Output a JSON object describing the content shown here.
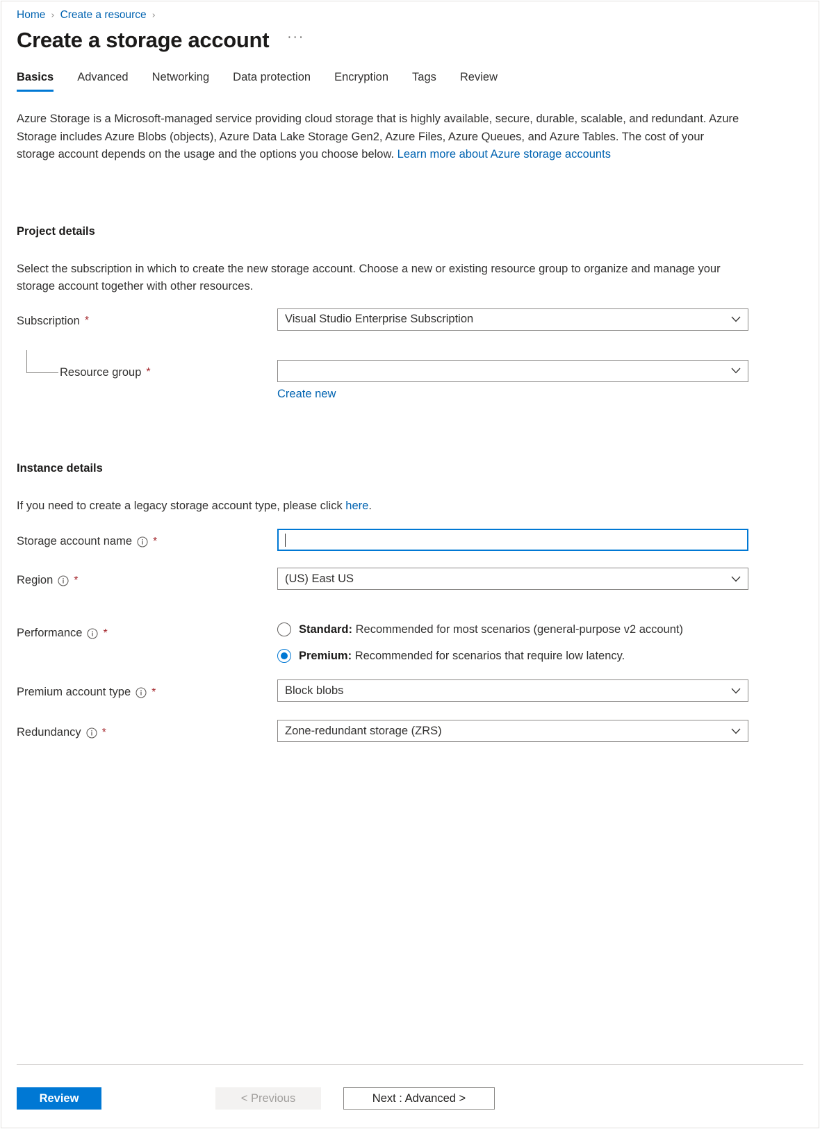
{
  "breadcrumb": {
    "items": [
      {
        "label": "Home",
        "link": true
      },
      {
        "label": "Create a resource",
        "link": true
      }
    ],
    "separator": "›"
  },
  "header": {
    "title": "Create a storage account",
    "more_menu": "···"
  },
  "tabs": [
    {
      "label": "Basics",
      "active": true
    },
    {
      "label": "Advanced",
      "active": false
    },
    {
      "label": "Networking",
      "active": false
    },
    {
      "label": "Data protection",
      "active": false
    },
    {
      "label": "Encryption",
      "active": false
    },
    {
      "label": "Tags",
      "active": false
    },
    {
      "label": "Review",
      "active": false
    }
  ],
  "intro": {
    "text": "Azure Storage is a Microsoft-managed service providing cloud storage that is highly available, secure, durable, scalable, and redundant. Azure Storage includes Azure Blobs (objects), Azure Data Lake Storage Gen2, Azure Files, Azure Queues, and Azure Tables. The cost of your storage account depends on the usage and the options you choose below. ",
    "link_text": "Learn more about Azure storage accounts"
  },
  "project_details": {
    "heading": "Project details",
    "description": "Select the subscription in which to create the new storage account. Choose a new or existing resource group to organize and manage your storage account together with other resources.",
    "subscription": {
      "label": "Subscription",
      "required": "*",
      "value": "Visual Studio Enterprise Subscription"
    },
    "resource_group": {
      "label": "Resource group",
      "required": "*",
      "value": "",
      "create_new_label": "Create new"
    }
  },
  "instance_details": {
    "heading": "Instance details",
    "legacy_note": {
      "text_before": "If you need to create a legacy storage account type, please click ",
      "link_text": "here",
      "text_after": "."
    },
    "storage_account_name": {
      "label": "Storage account name",
      "required": "*",
      "value": "",
      "placeholder": "",
      "focused": true,
      "info_icon": "info-icon"
    },
    "region": {
      "label": "Region",
      "required": "*",
      "value": "(US) East US",
      "info_icon": "info-icon"
    },
    "performance": {
      "label": "Performance",
      "required": "*",
      "info_icon": "info-icon",
      "options": [
        {
          "bold": "Standard:",
          "text": " Recommended for most scenarios (general-purpose v2 account)",
          "selected": false
        },
        {
          "bold": "Premium:",
          "text": " Recommended for scenarios that require low latency.",
          "selected": true
        }
      ]
    },
    "premium_account_type": {
      "label": "Premium account type",
      "required": "*",
      "value": "Block blobs",
      "info_icon": "info-icon"
    },
    "redundancy": {
      "label": "Redundancy",
      "required": "*",
      "value": "Zone-redundant storage (ZRS)",
      "info_icon": "info-icon"
    }
  },
  "footer": {
    "review_label": "Review",
    "previous_label": "< Previous",
    "next_label": "Next : Advanced >"
  },
  "colors": {
    "accent": "#0078d4",
    "link": "#0063b1",
    "required": "#a4262c",
    "border": "#8a8886",
    "disabled_bg": "#f3f2f1",
    "disabled_text": "#a19f9d"
  }
}
